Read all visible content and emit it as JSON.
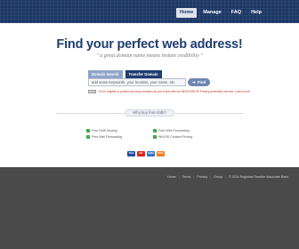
{
  "nav": {
    "items": [
      {
        "label": "Home",
        "active": true
      },
      {
        "label": "Manage",
        "active": false
      },
      {
        "label": "FAQ",
        "active": false
      },
      {
        "label": "Help",
        "active": false
      }
    ]
  },
  "hero": {
    "headline": "Find your perfect web address!",
    "tagline": "\" a great domain name means instant credibility \""
  },
  "search": {
    "tabs": [
      {
        "label": "Domain Search",
        "active": false
      },
      {
        "label": "Transfer Domain",
        "active": true
      }
    ],
    "input_value": "add some keywords, your location, your name, etc",
    "button_label": "Find",
    "notice_badge": "NEW",
    "notice_text": "You're eligible to protect as many domains as you'd like with our NEW WHOIS Privacy protection service. Learn more"
  },
  "why": {
    "label": "Why buy from Edk?",
    "features": [
      "Free DNS hosting",
      "Free Web Forwarding",
      "Free Mail Forwarding",
      "WHOIS Contact Privacy"
    ]
  },
  "payments": {
    "cards": [
      {
        "label": "VISA",
        "color": "#1a4fa0"
      },
      {
        "label": "MC",
        "color": "#d9261c"
      },
      {
        "label": "AMEX",
        "color": "#2e77bc"
      },
      {
        "label": "DISC",
        "color": "#f07f1a"
      }
    ]
  },
  "footer": {
    "links": [
      "Home",
      "Terms",
      "Privacy",
      "Group"
    ],
    "copyright": "© 2024 Registrar Reseller Associate Bank"
  },
  "colors": {
    "brand_navy": "#1d3766",
    "headline": "#1f3d70",
    "background_dark": "#4a4a4a"
  }
}
